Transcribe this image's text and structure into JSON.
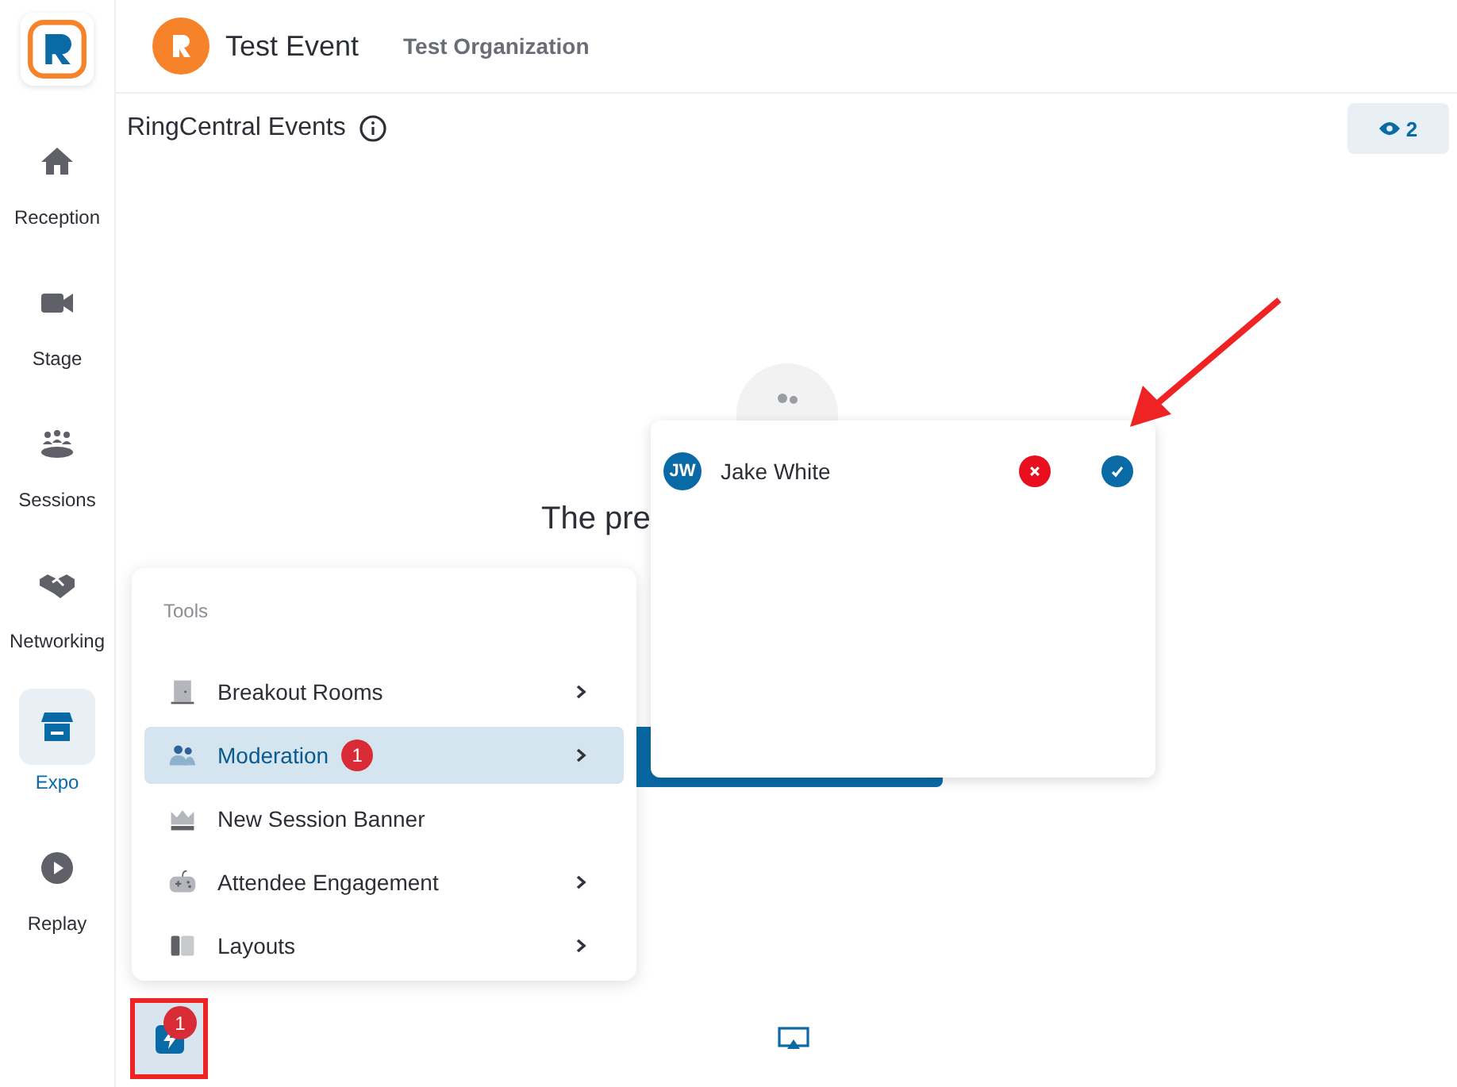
{
  "sidebar": {
    "items": [
      {
        "label": "Reception",
        "selected": false
      },
      {
        "label": "Stage",
        "selected": false
      },
      {
        "label": "Sessions",
        "selected": false
      },
      {
        "label": "Networking",
        "selected": false
      },
      {
        "label": "Expo",
        "selected": true
      },
      {
        "label": "Replay",
        "selected": false
      }
    ]
  },
  "header": {
    "event_title": "Test Event",
    "organization": "Test Organization"
  },
  "stage": {
    "title": "RingCentral Events",
    "viewer_count": "2",
    "heading": "The pre"
  },
  "tools_menu": {
    "title": "Tools",
    "items": [
      {
        "label": "Breakout Rooms",
        "selected": false,
        "submenu": true
      },
      {
        "label": "Moderation",
        "selected": true,
        "submenu": true,
        "badge": "1"
      },
      {
        "label": "New Session Banner",
        "selected": false,
        "submenu": false
      },
      {
        "label": "Attendee Engagement",
        "selected": false,
        "submenu": true
      },
      {
        "label": "Layouts",
        "selected": false,
        "submenu": true
      }
    ]
  },
  "moderation_popup": {
    "requests": [
      {
        "initials": "JW",
        "name": "Jake White"
      }
    ]
  },
  "toolbar": {
    "tools_badge": "1"
  }
}
